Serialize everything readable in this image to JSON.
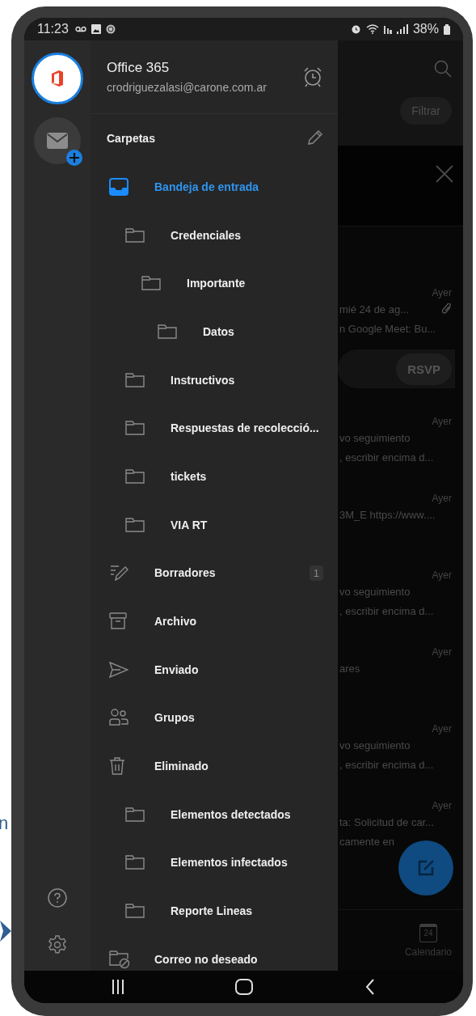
{
  "annotation": {
    "text": "n"
  },
  "status_bar": {
    "time": "11:23",
    "battery": "38%"
  },
  "account": {
    "name": "Office 365",
    "email": "crodriguezalasi@carone.com.ar"
  },
  "folders_header": "Carpetas",
  "folders": [
    {
      "kind": "inbox",
      "label": "Bandeja de entrada",
      "selected": true,
      "children": [
        {
          "kind": "folder",
          "label": "Credenciales",
          "selected": false,
          "children": [
            {
              "kind": "folder",
              "label": "Importante",
              "selected": false,
              "children": [
                {
                  "kind": "folder",
                  "label": "Datos",
                  "selected": false
                }
              ]
            }
          ]
        },
        {
          "kind": "folder",
          "label": "Instructivos",
          "selected": false
        },
        {
          "kind": "folder",
          "label": "Respuestas de recolecció...",
          "selected": false
        },
        {
          "kind": "folder",
          "label": "tickets",
          "selected": false
        },
        {
          "kind": "folder",
          "label": "VIA RT",
          "selected": false
        }
      ]
    },
    {
      "kind": "drafts",
      "label": "Borradores",
      "selected": false,
      "count": "1"
    },
    {
      "kind": "archive",
      "label": "Archivo",
      "selected": false
    },
    {
      "kind": "sent",
      "label": "Enviado",
      "selected": false
    },
    {
      "kind": "groups",
      "label": "Grupos",
      "selected": false
    },
    {
      "kind": "trash",
      "label": "Eliminado",
      "selected": false,
      "children": [
        {
          "kind": "folder",
          "label": "Elementos detectados",
          "selected": false
        },
        {
          "kind": "folder",
          "label": "Elementos infectados",
          "selected": false
        },
        {
          "kind": "folder",
          "label": "Reporte Lineas",
          "selected": false
        }
      ]
    },
    {
      "kind": "junk",
      "label": "Correo no deseado",
      "selected": false
    }
  ],
  "mail_list": {
    "filter_button": "Filtrar",
    "items": [
      {
        "date": "Ayer",
        "lines": [
          "mié 24 de ag...",
          "n Google Meet: Bu..."
        ],
        "attachment": true,
        "rsvp": "RSVP"
      },
      {
        "date": "Ayer",
        "lines": [
          "vo seguimiento",
          ", escribir encima d..."
        ]
      },
      {
        "date": "Ayer",
        "lines": [
          "3M_E https://www...."
        ]
      },
      {
        "date": "Ayer",
        "lines": [
          "vo seguimiento",
          ", escribir encima d..."
        ]
      },
      {
        "date": "Ayer",
        "lines": [
          "ares"
        ]
      },
      {
        "date": "Ayer",
        "lines": [
          "vo seguimiento",
          ", escribir encima d..."
        ]
      },
      {
        "date": "Ayer",
        "lines": [
          "ta: Solicitud de car...",
          "camente en"
        ]
      }
    ]
  },
  "bottom_nav": [
    {
      "label": "Calendario",
      "day": "24"
    }
  ]
}
